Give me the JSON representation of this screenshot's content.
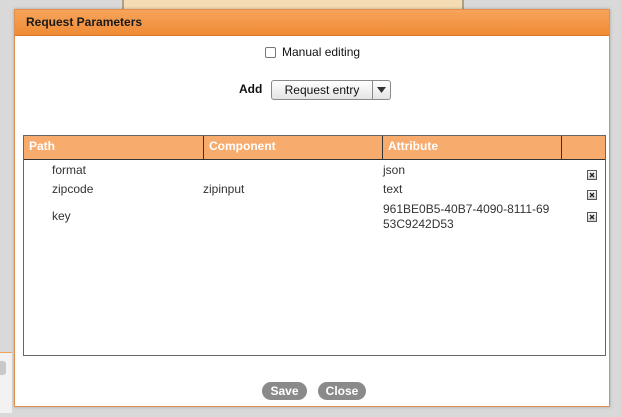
{
  "dialog": {
    "title": "Request Parameters"
  },
  "manual_editing": {
    "label": "Manual editing",
    "checked": false
  },
  "add": {
    "label": "Add",
    "selected": "Request entry"
  },
  "table": {
    "headers": [
      "Path",
      "Component",
      "Attribute",
      ""
    ],
    "rows": [
      {
        "path": "format",
        "component": "",
        "attribute": "json"
      },
      {
        "path": "zipcode",
        "component": "zipinput",
        "attribute": "text"
      },
      {
        "path": "key",
        "component": "",
        "attribute": "961BE0B5-40B7-4090-8111-6953C9242D53"
      }
    ]
  },
  "buttons": {
    "save": "Save",
    "close": "Close"
  },
  "colors": {
    "title_bar": "#ef8a35",
    "table_header": "#f7ab6d",
    "button": "#8a8a8a"
  },
  "icons": {
    "delete": "delete-icon",
    "dropdown": "chevron-down-icon"
  }
}
